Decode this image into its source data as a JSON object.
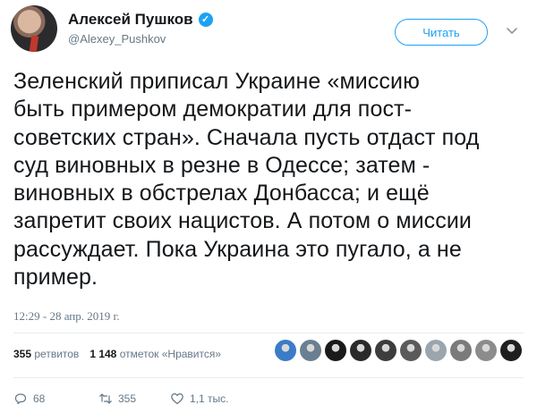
{
  "author": {
    "display_name": "Алексей Пушков",
    "handle": "@Alexey_Pushkov",
    "verified": true
  },
  "follow_button": {
    "label": "Читать"
  },
  "tweet": {
    "lines": [
      "Зеленский приписал Украине «миссию",
      "быть примером демократии для пост-",
      "советских стран». Сначала пусть отдаст под",
      "суд виновных в резне в Одессе; затем -",
      "виновных в обстрелах Донбасса; и ещё",
      "запретит своих нацистов. А потом о миссии",
      "рассуждает. Пока Украина это пугало, а не",
      "пример."
    ],
    "timestamp": "12:29 - 28 апр. 2019 г."
  },
  "stats": {
    "retweets_count": "355",
    "retweets_label": "ретвитов",
    "likes_count": "1 148",
    "likes_label": "отметок «Нравится»"
  },
  "likers": [
    {
      "icon": "avatar-ring",
      "color": "#3b7bc8"
    },
    {
      "icon": "avatar-silhouette",
      "color": "#6a7f91"
    },
    {
      "icon": "avatar-dark",
      "color": "#1a1a1a"
    },
    {
      "icon": "avatar-dark-figure",
      "color": "#2a2a2a"
    },
    {
      "icon": "avatar-emblem",
      "color": "#3d3d3d"
    },
    {
      "icon": "avatar-portrait",
      "color": "#5a5a5a"
    },
    {
      "icon": "avatar-default",
      "color": "#9aa5ae"
    },
    {
      "icon": "avatar-bald",
      "color": "#7a7a7a"
    },
    {
      "icon": "avatar-face",
      "color": "#8c8c8c"
    },
    {
      "icon": "avatar-mask",
      "color": "#1e1e1e"
    }
  ],
  "actions": {
    "reply_count": "68",
    "retweet_count": "355",
    "like_count": "1,1 тыс."
  },
  "colors": {
    "accent": "#1da1f2",
    "secondary_text": "#657786",
    "primary_text": "#14171a"
  }
}
